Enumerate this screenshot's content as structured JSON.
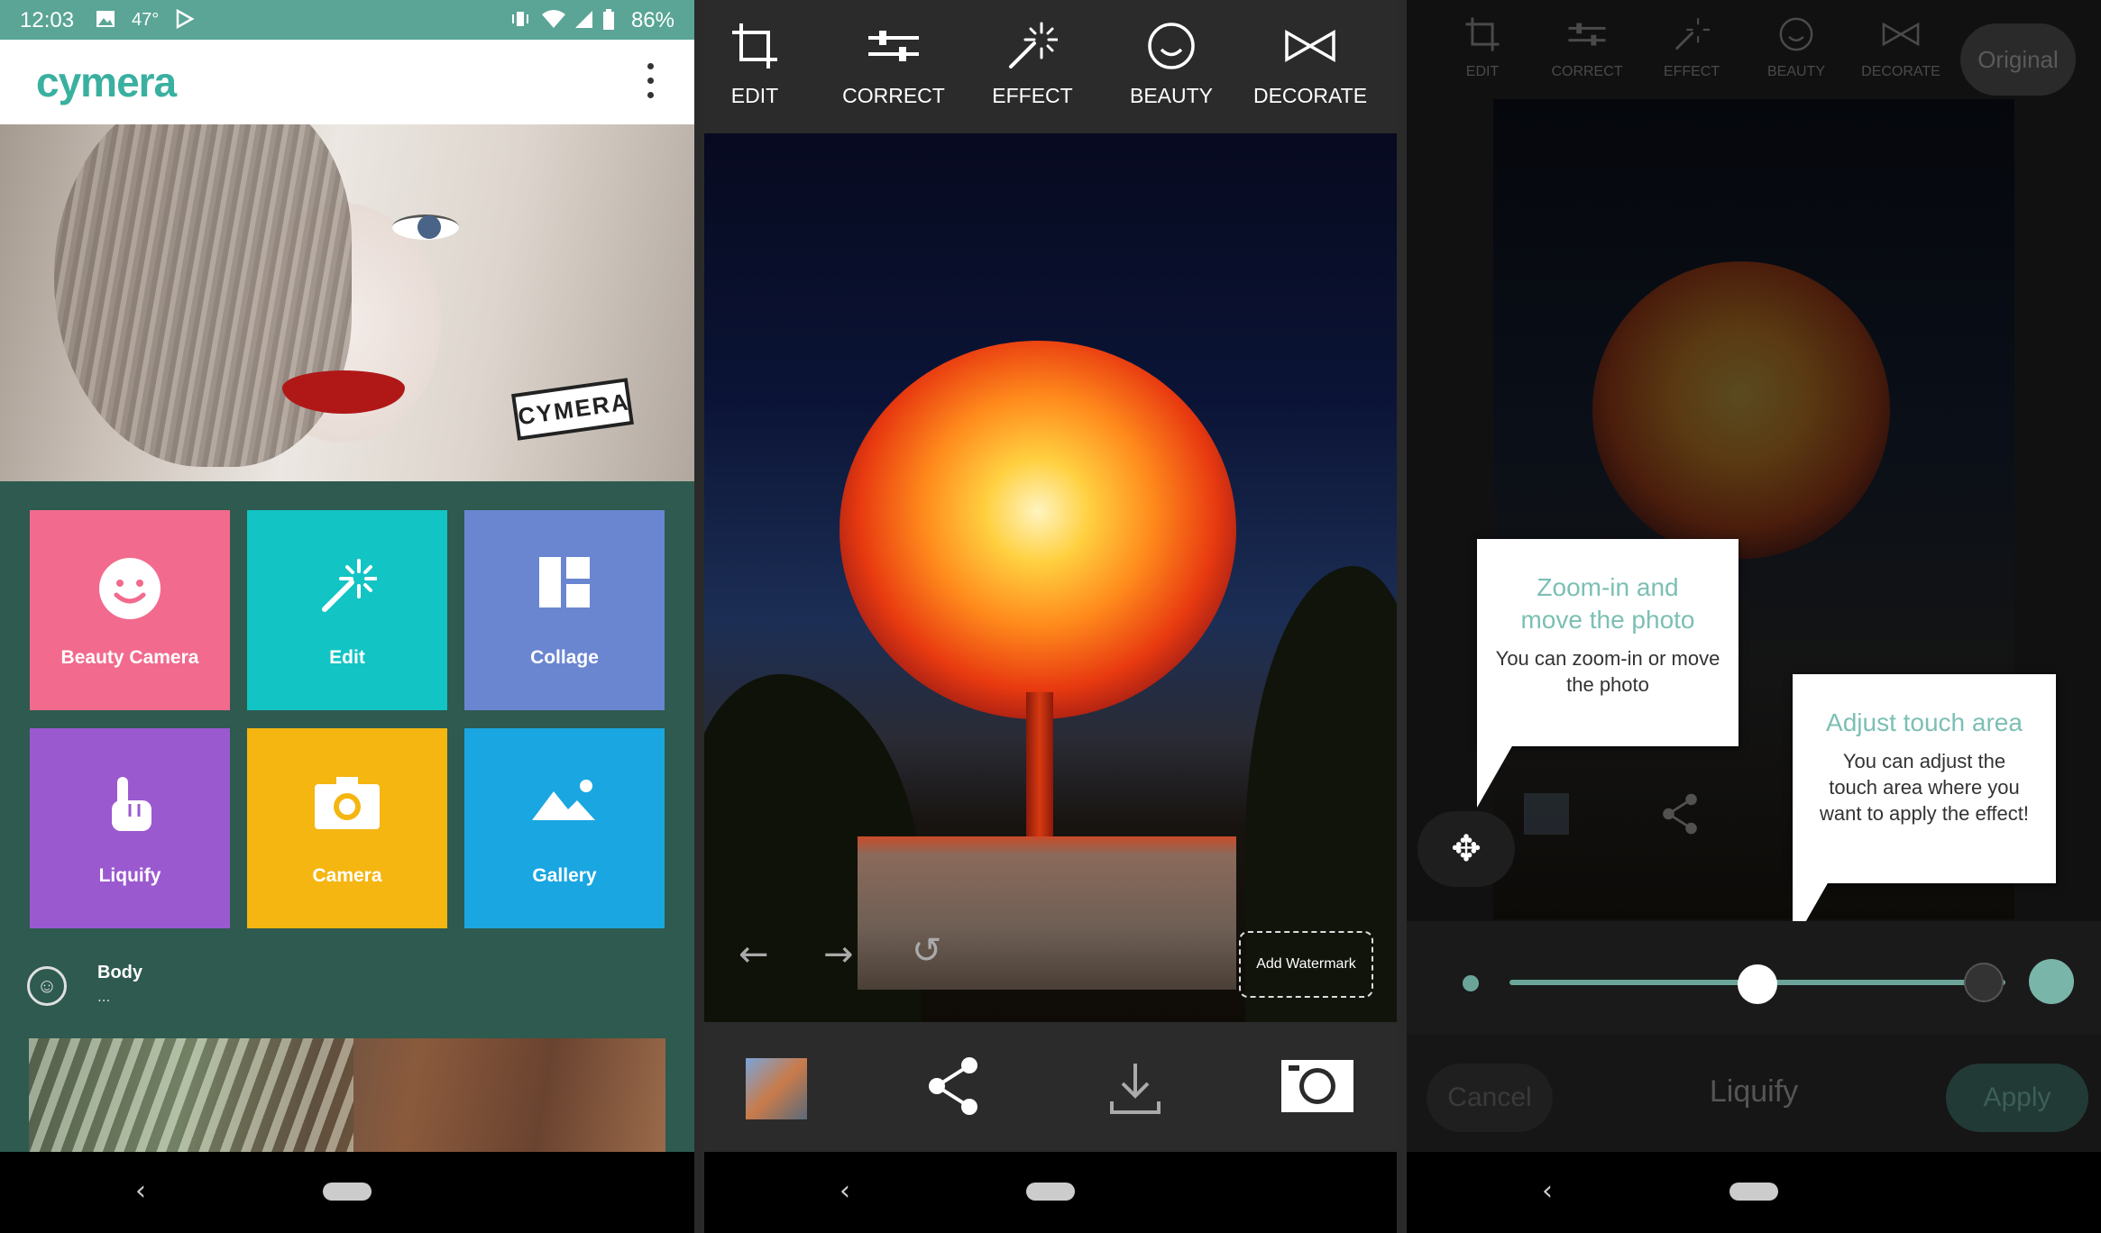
{
  "screen1": {
    "status": {
      "time": "12:03",
      "temp": "47°",
      "battery": "86%"
    },
    "app_logo": "cymera",
    "hero_tag": "CYMERA",
    "tiles": [
      {
        "label": "Beauty Camera",
        "color": "#f26a8d",
        "icon": "smile-icon"
      },
      {
        "label": "Edit",
        "color": "#12c4c4",
        "icon": "magic-wand-icon"
      },
      {
        "label": "Collage",
        "color": "#6a86d1",
        "icon": "collage-icon"
      },
      {
        "label": "Liquify",
        "color": "#9b59d0",
        "icon": "finger-icon"
      },
      {
        "label": "Camera",
        "color": "#f5b612",
        "icon": "camera-icon"
      },
      {
        "label": "Gallery",
        "color": "#1aa6e0",
        "icon": "mountain-icon"
      }
    ],
    "body_row": {
      "title": "Body",
      "subtitle": "..."
    }
  },
  "screen2": {
    "tools": [
      "EDIT",
      "CORRECT",
      "EFFECT",
      "BEAUTY",
      "DECORATE"
    ],
    "watermark_label": "Add Watermark"
  },
  "screen3": {
    "tools": [
      "EDIT",
      "CORRECT",
      "EFFECT",
      "BEAUTY",
      "DECORATE"
    ],
    "original_label": "Original",
    "tip1": {
      "title": "Zoom-in and move the photo",
      "body": "You can zoom-in or move the photo"
    },
    "tip2": {
      "title": "Adjust touch area",
      "body": "You can adjust the touch area where you want to apply the effect!"
    },
    "slider_level": 0.5,
    "cancel_label": "Cancel",
    "mode_title": "Liquify",
    "apply_label": "Apply"
  },
  "colors": {
    "accent": "#5aa596",
    "tip_title": "#7cbfb4",
    "app_bg": "#2e5a4f"
  }
}
